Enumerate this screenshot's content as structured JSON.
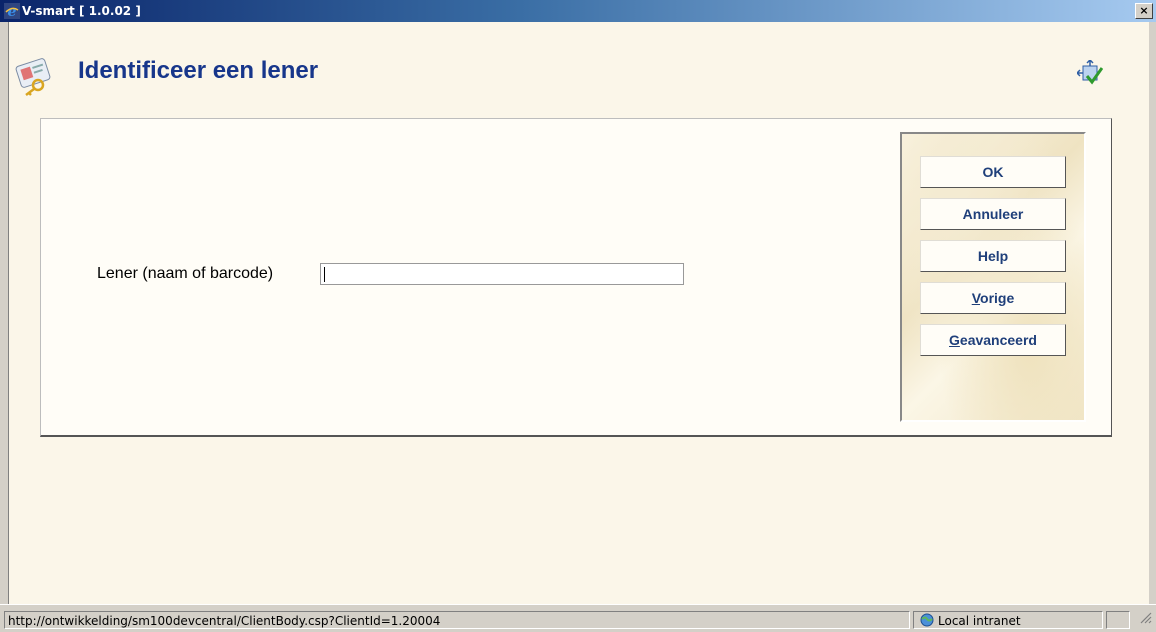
{
  "window": {
    "title": "V-smart [ 1.0.02 ]",
    "close_glyph": "×"
  },
  "page": {
    "title": "Identificeer een lener"
  },
  "form": {
    "lener_label": "Lener (naam of barcode)",
    "lener_value": ""
  },
  "buttons": {
    "ok": "OK",
    "annuleer": "Annuleer",
    "help": "Help",
    "vorige_rest": "orige",
    "vorige_u": "V",
    "geavanceerd_u": "G",
    "geavanceerd_rest": "eavanceerd"
  },
  "statusbar": {
    "url": "http://ontwikkelding/sm100devcentral/ClientBody.csp?ClientId=1.20004",
    "zone": "Local intranet"
  },
  "icons": {
    "app": "ie-logo-icon",
    "header": "id-card-key-icon",
    "corner": "layout-check-icon",
    "zone": "globe-icon"
  },
  "colors": {
    "title_text": "#17368b",
    "button_text": "#1f3f7a",
    "client_bg": "#fbf6e9"
  }
}
